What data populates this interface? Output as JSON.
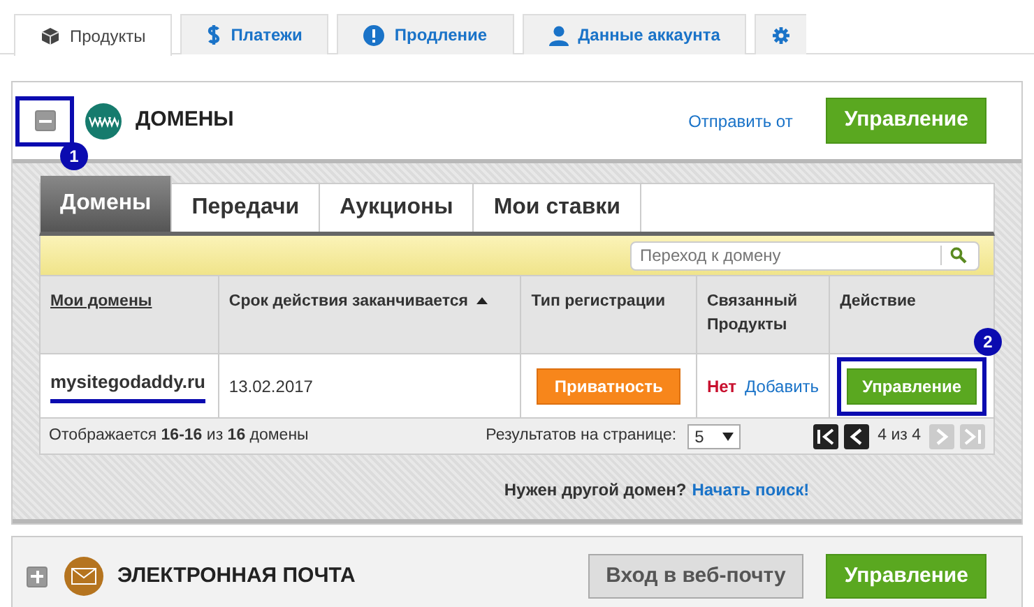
{
  "top_tabs": [
    {
      "kind": "box",
      "label": "Продукты",
      "selected": true
    },
    {
      "kind": "dollar",
      "label": "Платежи",
      "selected": false
    },
    {
      "kind": "alert",
      "label": "Продление",
      "selected": false
    },
    {
      "kind": "user",
      "label": "Данные аккаунта",
      "selected": false
    },
    {
      "kind": "gear",
      "selected": false
    }
  ],
  "domains": {
    "title": "ДОМЕНЫ",
    "expanded": true,
    "toggle_annotation": "1",
    "send_link": "Отправить от",
    "manage_button": "Управление",
    "tabs": [
      {
        "label": "Домены",
        "selected": true
      },
      {
        "label": "Передачи",
        "selected": false
      },
      {
        "label": "Аукционы",
        "selected": false
      },
      {
        "label": "Мои ставки",
        "selected": false
      }
    ],
    "search": {
      "placeholder": "Переход к домену"
    },
    "columns": [
      {
        "label": "Мои домены",
        "sorted": false,
        "underlined": true
      },
      {
        "label": "Срок действия заканчивается",
        "sorted": true,
        "underlined": false
      },
      {
        "label": "Тип регистрации",
        "sorted": false,
        "underlined": false
      },
      {
        "label": "Связанный Продукты",
        "sorted": false,
        "underlined": false
      },
      {
        "label": "Действие",
        "sorted": false,
        "underlined": false
      }
    ],
    "rows": [
      {
        "domain": "mysitegodaddy.ru",
        "highlighted": true,
        "expires": "13.02.2017",
        "registration_type": "Приватность",
        "related_status": "Нет",
        "related_link": "Добавить",
        "action": "Управление",
        "action_annotation": "2"
      }
    ],
    "footer": {
      "shown": "Отображается **16-16** из **16** домены",
      "per_page_label": "Результатов на странице:",
      "per_page": "5",
      "page_text": "4 из 4",
      "pager_buttons": [
        {
          "kind": "first",
          "disabled": false
        },
        {
          "kind": "prev",
          "disabled": false
        },
        {
          "kind": "next",
          "disabled": true
        },
        {
          "kind": "last",
          "disabled": true
        }
      ]
    },
    "search_prompt": "Нужен другой домен?",
    "search_link": "Начать поиск!"
  },
  "email": {
    "title": "ЭЛЕКТРОННАЯ ПОЧТА",
    "expanded": false,
    "webmail_button": "Вход в веб-почту",
    "manage_button": "Управление"
  }
}
